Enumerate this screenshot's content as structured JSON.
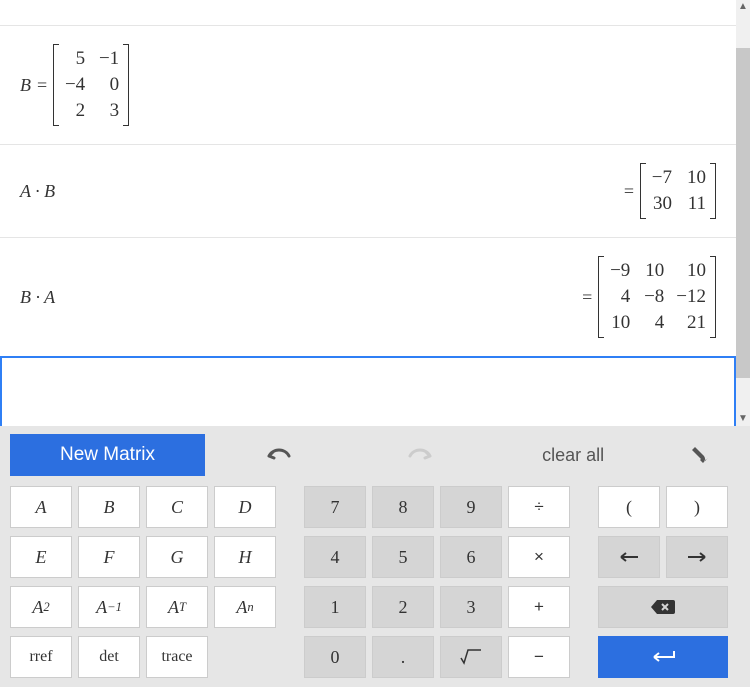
{
  "rows": [
    {
      "lhs_var": "B",
      "lhs_eq": "=",
      "lhs_matrix": [
        [
          "5",
          "−1"
        ],
        [
          "−4",
          "0"
        ],
        [
          "2",
          "3"
        ]
      ]
    },
    {
      "lhs_expr": "A · B",
      "rhs_eq": "=",
      "rhs_matrix": [
        [
          "−7",
          "10"
        ],
        [
          "30",
          "11"
        ]
      ]
    },
    {
      "lhs_expr": "B · A",
      "rhs_eq": "=",
      "rhs_matrix": [
        [
          "−9",
          "10",
          "10"
        ],
        [
          "4",
          "−8",
          "−12"
        ],
        [
          "10",
          "4",
          "21"
        ]
      ]
    }
  ],
  "toolbar": {
    "new_matrix": "New Matrix",
    "clear_all": "clear all"
  },
  "keys": {
    "letters": [
      "A",
      "B",
      "C",
      "D",
      "E",
      "F",
      "G",
      "H"
    ],
    "powers": [
      {
        "base": "A",
        "sup": "2"
      },
      {
        "base": "A",
        "sup": "−1"
      },
      {
        "base": "A",
        "sup": "T"
      },
      {
        "base": "A",
        "sup": "n"
      }
    ],
    "funcs": [
      "rref",
      "det",
      "trace"
    ],
    "numbers": [
      "7",
      "8",
      "9",
      "4",
      "5",
      "6",
      "1",
      "2",
      "3",
      "0"
    ],
    "dot": ".",
    "sqrt": "√",
    "ops": {
      "div": "÷",
      "mul": "×",
      "add": "+",
      "sub": "−"
    },
    "parens": {
      "open": "(",
      "close": ")"
    },
    "arrows": {
      "left": "←",
      "right": "→"
    }
  },
  "chart_data": {
    "type": "table",
    "matrices": {
      "B": [
        [
          5,
          -1
        ],
        [
          -4,
          0
        ],
        [
          2,
          3
        ]
      ],
      "A_times_B": [
        [
          -7,
          10
        ],
        [
          30,
          11
        ]
      ],
      "B_times_A": [
        [
          -9,
          10,
          10
        ],
        [
          4,
          -8,
          -12
        ],
        [
          10,
          4,
          21
        ]
      ]
    }
  }
}
